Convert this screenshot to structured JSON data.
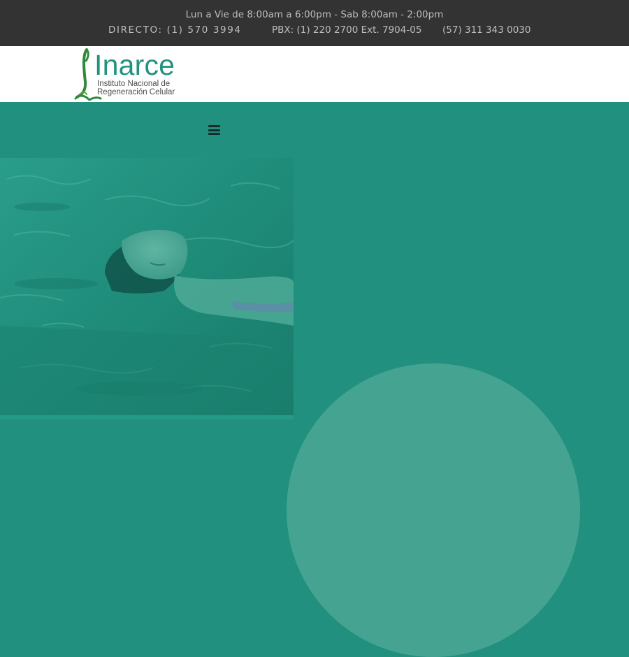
{
  "topbar": {
    "hours": "Lun a Vie de 8:00am a 6:00pm - Sab 8:00am - 2:00pm",
    "direct": "DIRECTO: (1) 570 3994",
    "pbx": "PBX: (1) 220 2700 Ext. 7904-05",
    "mobile": "(57) 311 343 0030"
  },
  "logo": {
    "word": "Inarce",
    "subtitle_line1": "Instituto Nacional de",
    "subtitle_line2": "Regeneración Celular"
  },
  "nav": {
    "menu_icon": "hamburger-menu-icon"
  },
  "hero": {
    "image": "woman-floating-in-pool-photo"
  },
  "colors": {
    "topbar_bg": "#333333",
    "brand_teal": "#22907f",
    "logo_green": "#21927e",
    "accent_light_teal": "#45a392"
  }
}
